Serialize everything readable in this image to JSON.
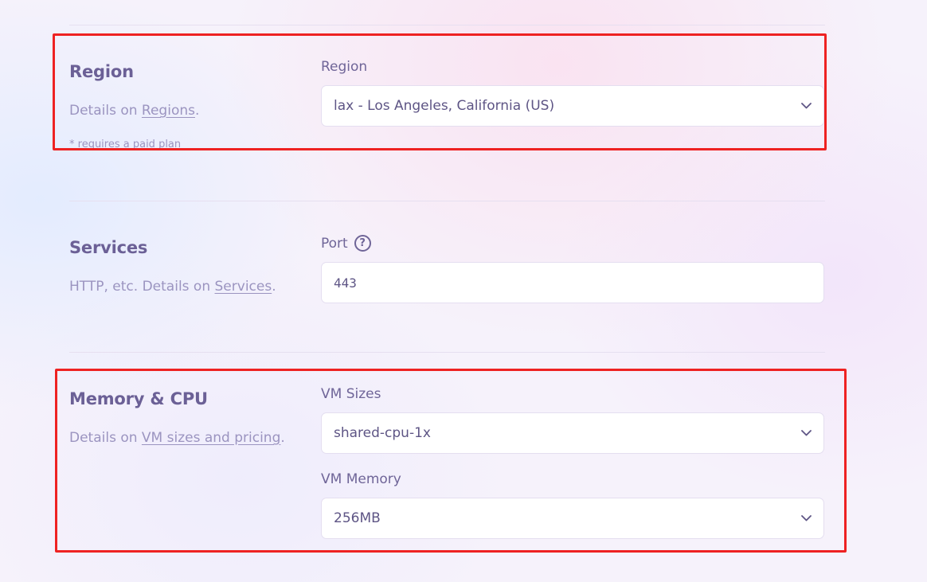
{
  "region": {
    "title": "Region",
    "desc_prefix": "Details on ",
    "desc_link": "Regions",
    "desc_suffix": ".",
    "note": "* requires a paid plan",
    "field_label": "Region",
    "selected": "lax - Los Angeles, California (US)"
  },
  "services": {
    "title": "Services",
    "desc_prefix": "HTTP, etc. Details on ",
    "desc_link": "Services",
    "desc_suffix": ".",
    "port_label": "Port",
    "port_help_icon": "?",
    "port_value": "443"
  },
  "memory_cpu": {
    "title": "Memory & CPU",
    "desc_prefix": "Details on ",
    "desc_link": "VM sizes and pricing",
    "desc_suffix": ".",
    "vm_sizes_label": "VM Sizes",
    "vm_sizes_selected": "shared-cpu-1x",
    "vm_memory_label": "VM Memory",
    "vm_memory_selected": "256MB"
  },
  "icons": {
    "select_arrow": "chevron-down-icon",
    "help": "question-circle-icon"
  },
  "colors": {
    "accent_text": "#6b6096",
    "muted_text": "#9b94c0",
    "highlight_box": "#ee2222"
  }
}
